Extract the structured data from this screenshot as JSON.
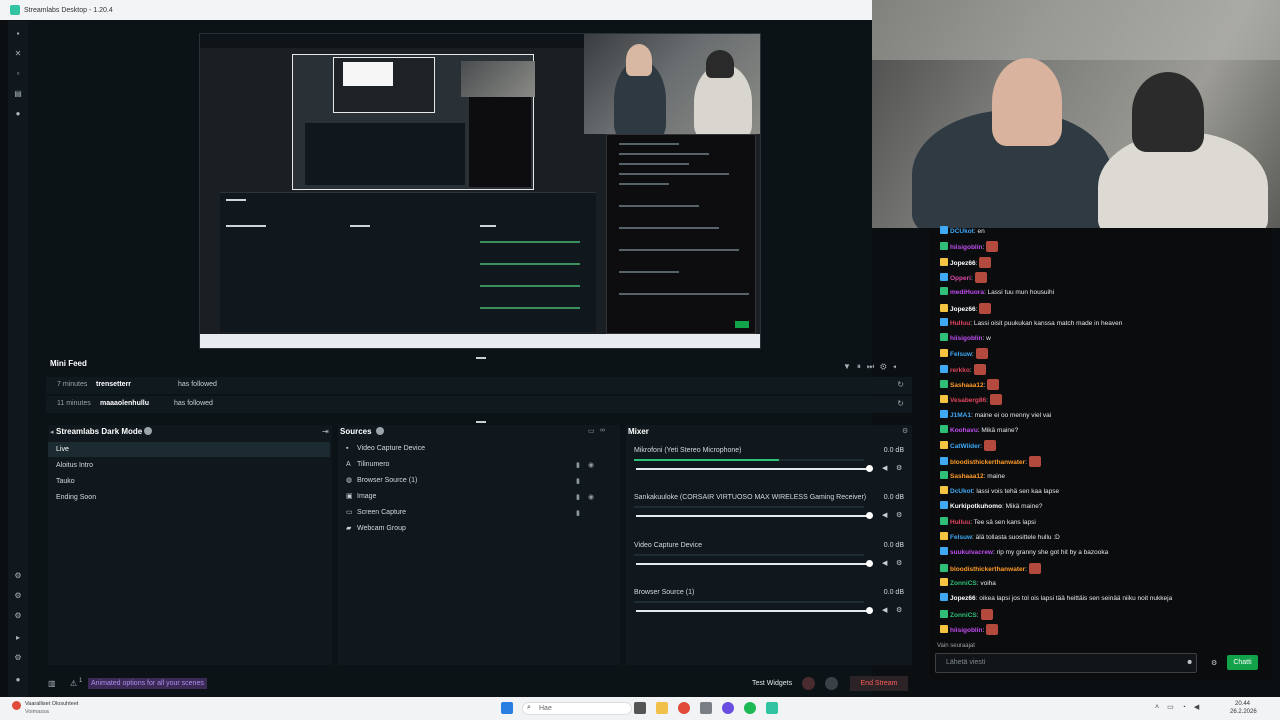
{
  "window": {
    "title": "Streamlabs Desktop - 1.20.4"
  },
  "minifeed": {
    "title": "Mini Feed",
    "events": [
      {
        "time": "7 minutes",
        "user": "trensetterr",
        "action": "has followed"
      },
      {
        "time": "11 minutes",
        "user": "maaaolenhullu",
        "action": "has followed"
      }
    ]
  },
  "scenes": {
    "title": "Streamlabs Dark Mode",
    "items": [
      "Live",
      "Aloitus Intro",
      "Tauko",
      "Ending Soon"
    ]
  },
  "sources": {
    "title": "Sources",
    "items": [
      {
        "icon": "video-icon",
        "label": "Video Capture Device"
      },
      {
        "icon": "text-icon",
        "label": "Tilinumero"
      },
      {
        "icon": "browser-icon",
        "label": "Browser Source (1)"
      },
      {
        "icon": "image-icon",
        "label": "Image"
      },
      {
        "icon": "monitor-icon",
        "label": "Screen Capture"
      },
      {
        "icon": "folder-icon",
        "label": "Webcam Group"
      }
    ]
  },
  "mixer": {
    "title": "Mixer",
    "channels": [
      {
        "name": "Mikrofoni (Yeti Stereo Microphone)",
        "db": "0.0 dB",
        "level": 0.63
      },
      {
        "name": "Sankakuuloke (CORSAIR VIRTUOSO MAX WIRELESS Gaming Receiver)",
        "db": "0.0 dB",
        "level": 0
      },
      {
        "name": "Video Capture Device",
        "db": "0.0 dB",
        "level": 0
      },
      {
        "name": "Browser Source (1)",
        "db": "0.0 dB",
        "level": 0
      }
    ]
  },
  "bottombar": {
    "animated_options": "Animated options for all your scenes",
    "test_widgets": "Test Widgets",
    "end_stream": "End Stream",
    "alert_count": "1"
  },
  "chat": {
    "messages": [
      {
        "user": "DCUkot",
        "color": "#3fa9f5",
        "text": ": en"
      },
      {
        "user": "hiisigoblin",
        "color": "#c04df0",
        "text": ":"
      },
      {
        "user": "Jopez66",
        "color": "#ffffff",
        "text": ":"
      },
      {
        "user": "Opperi",
        "color": "#d94aa4",
        "text": ":"
      },
      {
        "user": "mediHuora",
        "color": "#c04df0",
        "text": ": Lassi tuu mun housuihi"
      },
      {
        "user": "Jopez66",
        "color": "#ffffff",
        "text": ":"
      },
      {
        "user": "Hulluu",
        "color": "#e0455b",
        "text": ": Lassi oisit puukukan kanssa match made in heaven"
      },
      {
        "user": "hiisigoblin",
        "color": "#c04df0",
        "text": ": w"
      },
      {
        "user": "Felsuw",
        "color": "#3fa9f5",
        "text": ":"
      },
      {
        "user": "rerkko",
        "color": "#e0455b",
        "text": ":"
      },
      {
        "user": "Sashaaa12",
        "color": "#ff9b28",
        "text": ":"
      },
      {
        "user": "Vesaberg86",
        "color": "#e0455b",
        "text": ":"
      },
      {
        "user": "J1MA1",
        "color": "#3fa9f5",
        "text": ": maine ei oo menny viel vai"
      },
      {
        "user": "Koohavu",
        "color": "#c04df0",
        "text": ": Mikä maine?"
      },
      {
        "user": "CatWilder",
        "color": "#3fa9f5",
        "text": ":"
      },
      {
        "user": "bloodisthickerthanwater",
        "color": "#ff9b28",
        "text": ":"
      },
      {
        "user": "Sashaaa12",
        "color": "#ff9b28",
        "text": ": maine"
      },
      {
        "user": "DcUkot",
        "color": "#3fa9f5",
        "text": ": lassi vois tehä sen kaa lapse"
      },
      {
        "user": "Kurkipotkuhomo",
        "color": "#ffffff",
        "text": ": Mikä maine?"
      },
      {
        "user": "Hulluu",
        "color": "#e0455b",
        "text": ": Tee sä sen kans lapsi"
      },
      {
        "user": "Felsuw",
        "color": "#3fa9f5",
        "text": ": älä tollasta suosittele hullu :D"
      },
      {
        "user": "suukuivacrew",
        "color": "#c04df0",
        "text": ": rip my granny she got hit by a bazooka"
      },
      {
        "user": "bloodisthickerthanwater",
        "color": "#ff9b28",
        "text": ":"
      },
      {
        "user": "ZonniCS",
        "color": "#2fbf79",
        "text": ": voiha"
      },
      {
        "user": "Jopez66",
        "color": "#ffffff",
        "text": ": oikea lapsi jos tol ois lapsi tää heittäis sen seinää niiku noit nukkeja"
      },
      {
        "user": "ZonniCS",
        "color": "#2fbf79",
        "text": ":"
      },
      {
        "user": "hiisigoblin",
        "color": "#c04df0",
        "text": ":"
      }
    ],
    "followers_only": "Vain seuraajat",
    "input_placeholder": "Lähetä viesti",
    "send_label": "Chatti"
  },
  "taskbar": {
    "weather_title": "Vaaralliset Olosuhteet",
    "weather_sub": "Voimassa",
    "search_placeholder": "Hae",
    "time": "20.44",
    "date": "26.2.2026"
  },
  "colors": {
    "accent": "#31c3a2",
    "end_stream": "#ff5a5a",
    "chat_send": "#12a24a"
  }
}
